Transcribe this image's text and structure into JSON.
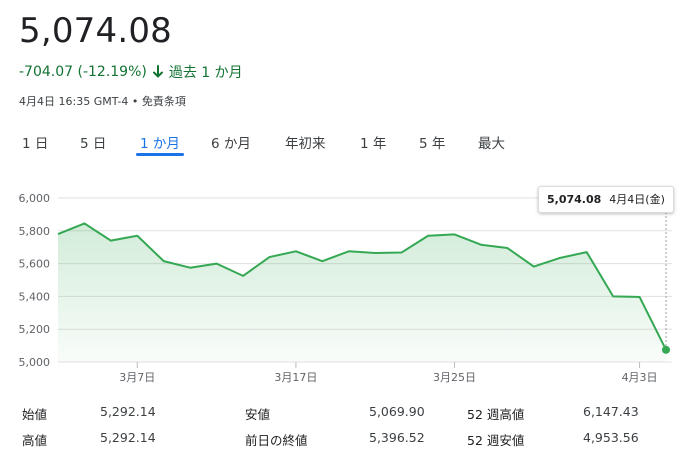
{
  "header": {
    "price": "5,074.08",
    "change_text": "-704.07 (-12.19%)",
    "period_text": "過去 1 か月",
    "meta_text": "4月4日 16:35 GMT-4 • 免責条項"
  },
  "tabs": [
    {
      "label": "1 日",
      "active": false
    },
    {
      "label": "5 日",
      "active": false
    },
    {
      "label": "1 か月",
      "active": true
    },
    {
      "label": "6 か月",
      "active": false
    },
    {
      "label": "年初来",
      "active": false
    },
    {
      "label": "1 年",
      "active": false
    },
    {
      "label": "5 年",
      "active": false
    },
    {
      "label": "最大",
      "active": false
    }
  ],
  "tooltip": {
    "value": "5,074.08",
    "date": "4月4日(金)"
  },
  "colors": {
    "line": "#34a853",
    "fill": "#e6f4ea",
    "negative": "#137333",
    "accent": "#1a73e8",
    "grid": "#e0e0e0"
  },
  "chart_data": {
    "type": "area",
    "x": [
      "3月4日",
      "3月5日",
      "3月6日",
      "3月7日",
      "3月10日",
      "3月11日",
      "3月12日",
      "3月13日",
      "3月14日",
      "3月17日",
      "3月18日",
      "3月19日",
      "3月20日",
      "3月21日",
      "3月24日",
      "3月25日",
      "3月26日",
      "3月27日",
      "3月28日",
      "3月31日",
      "4月1日",
      "4月2日",
      "4月3日",
      "4月4日"
    ],
    "series": [
      {
        "values": [
          5780,
          5845,
          5740,
          5770,
          5615,
          5575,
          5600,
          5525,
          5640,
          5675,
          5615,
          5675,
          5665,
          5668,
          5770,
          5778,
          5715,
          5695,
          5582,
          5635,
          5670,
          5400,
          5396.52,
          5074.08
        ]
      }
    ],
    "ylim": [
      5000,
      6000
    ],
    "yticks": [
      {
        "value": 6000,
        "label": "6,000"
      },
      {
        "value": 5800,
        "label": "5,800"
      },
      {
        "value": 5600,
        "label": "5,600"
      },
      {
        "value": 5400,
        "label": "5,400"
      },
      {
        "value": 5200,
        "label": "5,200"
      },
      {
        "value": 5000,
        "label": "5,000"
      }
    ],
    "xticks": [
      {
        "index": 3,
        "label": "3月7日"
      },
      {
        "index": 9,
        "label": "3月17日"
      },
      {
        "index": 15,
        "label": "3月25日"
      },
      {
        "index": 22,
        "label": "4月3日"
      }
    ],
    "grid": true
  },
  "stats": [
    {
      "label": "始値",
      "value": "5,292.14"
    },
    {
      "label": "安値",
      "value": "5,069.90"
    },
    {
      "label": "52 週高値",
      "value": "6,147.43"
    },
    {
      "label": "高値",
      "value": "5,292.14"
    },
    {
      "label": "前日の終値",
      "value": "5,396.52"
    },
    {
      "label": "52 週安値",
      "value": "4,953.56"
    }
  ]
}
